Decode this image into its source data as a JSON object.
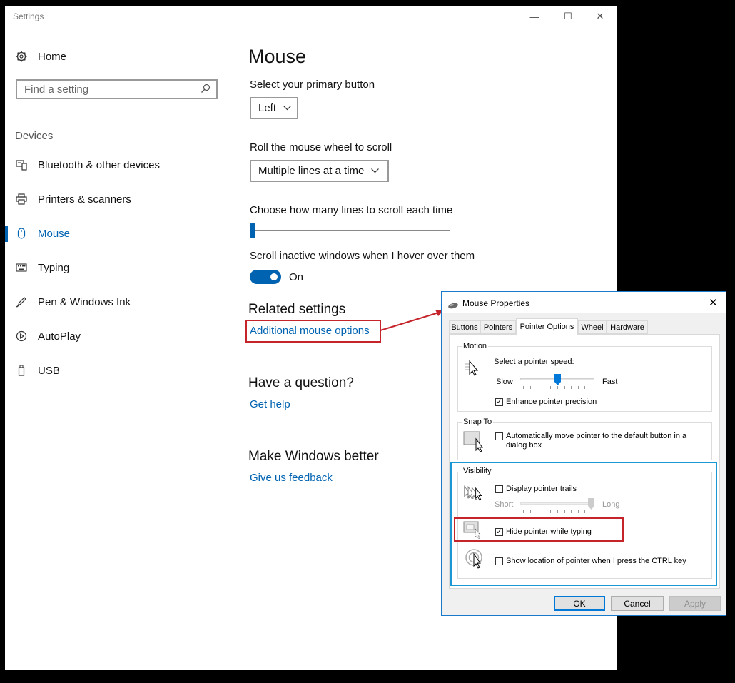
{
  "window": {
    "title": "Settings",
    "minimize": "—",
    "maximize": "☐",
    "close": "✕"
  },
  "sidebar": {
    "home_label": "Home",
    "search_placeholder": "Find a setting",
    "section": "Devices",
    "items": [
      {
        "label": "Bluetooth & other devices",
        "icon": "bluetooth-devices-icon"
      },
      {
        "label": "Printers & scanners",
        "icon": "printer-icon"
      },
      {
        "label": "Mouse",
        "icon": "mouse-icon",
        "selected": true
      },
      {
        "label": "Typing",
        "icon": "keyboard-icon"
      },
      {
        "label": "Pen & Windows Ink",
        "icon": "pen-icon"
      },
      {
        "label": "AutoPlay",
        "icon": "autoplay-icon"
      },
      {
        "label": "USB",
        "icon": "usb-icon"
      }
    ]
  },
  "main": {
    "title": "Mouse",
    "primary_button": {
      "label": "Select your primary button",
      "value": "Left"
    },
    "wheel_scroll": {
      "label": "Roll the mouse wheel to scroll",
      "value": "Multiple lines at a time"
    },
    "lines_to_scroll": {
      "label": "Choose how many lines to scroll each time",
      "level": 0.0
    },
    "inactive_scroll": {
      "label": "Scroll inactive windows when I hover over them",
      "state": "On",
      "on": true
    },
    "related": {
      "heading": "Related settings",
      "link": "Additional mouse options"
    },
    "question": {
      "heading": "Have a question?",
      "link": "Get help"
    },
    "better": {
      "heading": "Make Windows better",
      "link": "Give us feedback"
    }
  },
  "dialog": {
    "title": "Mouse Properties",
    "close": "✕",
    "tabs": [
      "Buttons",
      "Pointers",
      "Pointer Options",
      "Wheel",
      "Hardware"
    ],
    "active_tab": "Pointer Options",
    "motion": {
      "group": "Motion",
      "speed_label": "Select a pointer speed:",
      "slow": "Slow",
      "fast": "Fast",
      "speed_level": 0.5,
      "precision_label": "Enhance pointer precision",
      "precision_checked": true
    },
    "snap": {
      "group": "Snap To",
      "label": "Automatically move pointer to the default button in a dialog box",
      "checked": false
    },
    "visibility": {
      "group": "Visibility",
      "trails_label": "Display pointer trails",
      "trails_checked": false,
      "short": "Short",
      "long": "Long",
      "trails_level": 1.0,
      "hide_label": "Hide pointer while typing",
      "hide_checked": true,
      "ctrl_label": "Show location of pointer when I press the CTRL key",
      "ctrl_checked": false
    },
    "buttons": {
      "ok": "OK",
      "cancel": "Cancel",
      "apply": "Apply"
    }
  },
  "colors": {
    "accent": "#0063b1",
    "highlight_red": "#c5242b",
    "highlight_blue": "#1a98d5",
    "dialog_border": "#1979ca"
  },
  "check_mark": "✓"
}
